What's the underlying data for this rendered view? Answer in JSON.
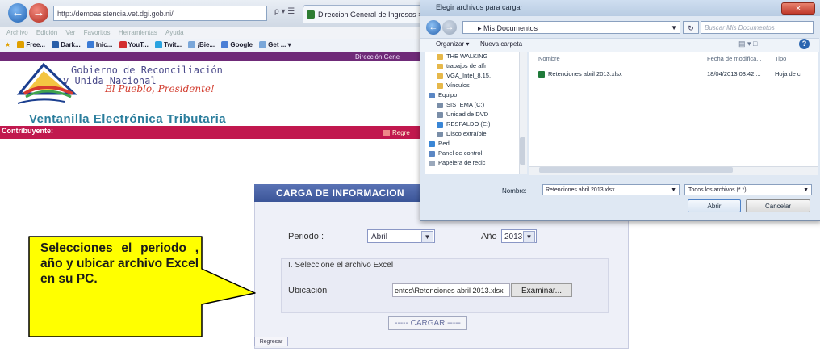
{
  "browser": {
    "address": "http://demoasistencia.vet.dgi.gob.ni/",
    "address_tools": "ρ ▾ ☰",
    "tab_title": "Direccion General de Ingresos ×",
    "menu": [
      "Archivo",
      "Edición",
      "Ver",
      "Favoritos",
      "Herramientas",
      "Ayuda"
    ],
    "favorites": [
      {
        "label": "Free...",
        "color": "#e0a000"
      },
      {
        "label": "Dark...",
        "color": "#2a5fa8"
      },
      {
        "label": "Inic...",
        "color": "#3a7bd5"
      },
      {
        "label": "YouT...",
        "color": "#d32f2f"
      },
      {
        "label": "Twit...",
        "color": "#29a3e0"
      },
      {
        "label": "¡Bie...",
        "color": "#7aa7d9"
      },
      {
        "label": "Google",
        "color": "#4a7fd6"
      },
      {
        "label": "Get ... ▾",
        "color": "#7aa7d9"
      }
    ]
  },
  "site": {
    "nav_strip_text": "Dirección Gene",
    "gov_line1": "Gobierno de Reconciliación",
    "gov_line2": "y Unida Nacional",
    "slogan": "El Pueblo, Presidente!",
    "title": "Ventanilla Electrónica Tributaria",
    "contrib_label": "Contribuyente:",
    "regresar_top": "Regre"
  },
  "form": {
    "title": "CARGA DE INFORMACION",
    "periodo_label": "Periodo :",
    "periodo_value": "Abril",
    "anio_label": "Año",
    "anio_value": "2013",
    "file_section_title": "I. Seleccione el archivo Excel",
    "ubicacion_label": "Ubicación",
    "file_value": "entos\\Retenciones abril 2013.xlsx",
    "examinar": "Examinar...",
    "cargar": "----- CARGAR -----",
    "regresar": "Regresar"
  },
  "callout": {
    "text": "Selecciones el periodo , año y ubicar archivo Excel en su PC."
  },
  "dialog": {
    "title": "Elegir archivos para cargar",
    "close": "✕",
    "path": "▸ Mis Documentos",
    "search_placeholder": "Buscar Mis Documentos",
    "organizar": "Organizar ▾",
    "nueva_carpeta": "Nueva carpeta",
    "nav_items": [
      {
        "label": "THE WALKING",
        "color": "#e6b84a"
      },
      {
        "label": "trabajos de alfr",
        "color": "#e6b84a"
      },
      {
        "label": "VGA_Intel_8.15.",
        "color": "#e6b84a"
      },
      {
        "label": "Vínculos",
        "color": "#e6b84a"
      },
      {
        "label": "Equipo",
        "color": "#5b87c4"
      },
      {
        "label": "SISTEMA (C:)",
        "color": "#7a8ea8"
      },
      {
        "label": "Unidad de DVD",
        "color": "#7a8ea8"
      },
      {
        "label": "RESPALDO (E:)",
        "color": "#3a86d6"
      },
      {
        "label": "Disco extraíble",
        "color": "#7a8ea8"
      },
      {
        "label": "Red",
        "color": "#3a86d6"
      },
      {
        "label": "Panel de control",
        "color": "#5b87c4"
      },
      {
        "label": "Papelera de recic",
        "color": "#9aa8bb"
      }
    ],
    "col_nombre": "Nombre",
    "col_fecha": "Fecha de modifica...",
    "col_tipo": "Tipo",
    "file_name": "Retenciones abril 2013.xlsx",
    "file_date": "18/04/2013 03:42 ...",
    "file_type": "Hoja de c",
    "nombre_label": "Nombre:",
    "nombre_value": "Retenciones abril 2013.xlsx",
    "filter": "Todos los archivos (*.*)",
    "open": "Abrir",
    "cancel": "Cancelar"
  }
}
